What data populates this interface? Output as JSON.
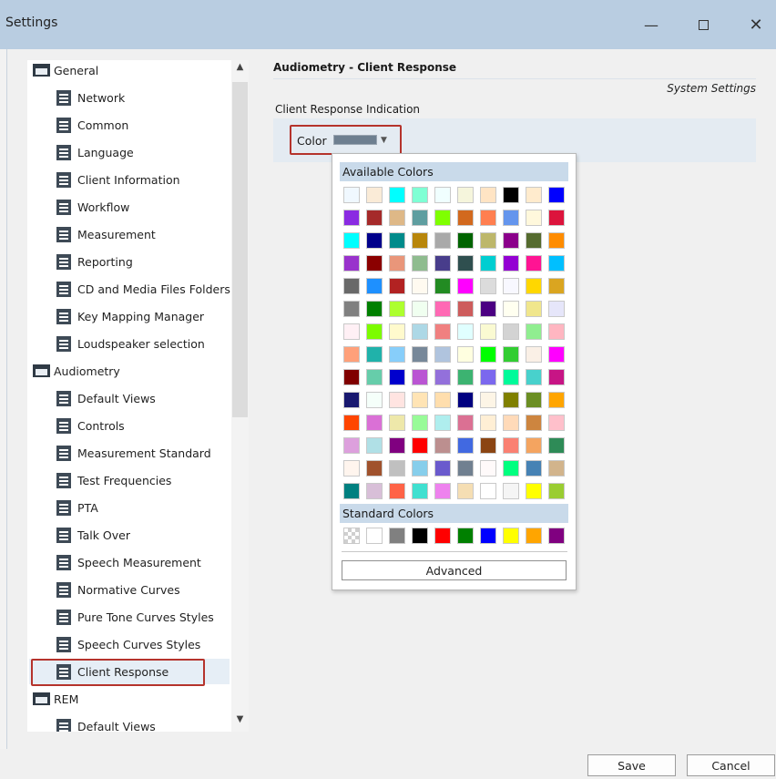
{
  "window": {
    "title": "Settings",
    "minimize": "—",
    "close": "✕"
  },
  "sidebar": {
    "items": [
      {
        "label": "General",
        "type": "folder"
      },
      {
        "label": "Network",
        "type": "doc"
      },
      {
        "label": "Common",
        "type": "doc"
      },
      {
        "label": "Language",
        "type": "doc"
      },
      {
        "label": "Client Information",
        "type": "doc"
      },
      {
        "label": "Workflow",
        "type": "doc"
      },
      {
        "label": "Measurement",
        "type": "doc"
      },
      {
        "label": "Reporting",
        "type": "doc"
      },
      {
        "label": "CD and Media Files Folders",
        "type": "doc"
      },
      {
        "label": "Key Mapping Manager",
        "type": "doc"
      },
      {
        "label": "Loudspeaker selection",
        "type": "doc"
      },
      {
        "label": "Audiometry",
        "type": "folder"
      },
      {
        "label": "Default Views",
        "type": "doc"
      },
      {
        "label": "Controls",
        "type": "doc"
      },
      {
        "label": "Measurement Standard",
        "type": "doc"
      },
      {
        "label": "Test Frequencies",
        "type": "doc"
      },
      {
        "label": "PTA",
        "type": "doc"
      },
      {
        "label": "Talk Over",
        "type": "doc"
      },
      {
        "label": "Speech Measurement",
        "type": "doc"
      },
      {
        "label": "Normative Curves",
        "type": "doc"
      },
      {
        "label": "Pure Tone Curves Styles",
        "type": "doc"
      },
      {
        "label": "Speech Curves Styles",
        "type": "doc"
      },
      {
        "label": "Client Response",
        "type": "doc",
        "selected": true
      },
      {
        "label": "REM",
        "type": "folder"
      },
      {
        "label": "Default Views",
        "type": "doc"
      }
    ]
  },
  "main": {
    "section_title": "Audiometry - Client Response",
    "system_settings": "System Settings",
    "indication_label": "Client Response Indication",
    "color_label": "Color",
    "selected_color": "#6e7f90"
  },
  "color_popup": {
    "available_title": "Available Colors",
    "standard_title": "Standard Colors",
    "advanced_label": "Advanced",
    "available_colors": [
      "#f0f8ff",
      "#faebd7",
      "#00ffff",
      "#7fffd4",
      "#f0ffff",
      "#f5f5dc",
      "#ffe4c4",
      "#000000",
      "#ffebcd",
      "#0000ff",
      "#8a2be2",
      "#a52a2a",
      "#deb887",
      "#5f9ea0",
      "#7fff00",
      "#d2691e",
      "#ff7f50",
      "#6495ed",
      "#fff8dc",
      "#dc143c",
      "#00ffff",
      "#00008b",
      "#008b8b",
      "#b8860b",
      "#a9a9a9",
      "#006400",
      "#bdb76b",
      "#8b008b",
      "#556b2f",
      "#ff8c00",
      "#9932cc",
      "#8b0000",
      "#e9967a",
      "#8fbc8f",
      "#483d8b",
      "#2f4f4f",
      "#00ced1",
      "#9400d3",
      "#ff1493",
      "#00bfff",
      "#696969",
      "#1e90ff",
      "#b22222",
      "#fffaf0",
      "#228b22",
      "#ff00ff",
      "#dcdcdc",
      "#f8f8ff",
      "#ffd700",
      "#daa520",
      "#808080",
      "#008000",
      "#adff2f",
      "#f0fff0",
      "#ff69b4",
      "#cd5c5c",
      "#4b0082",
      "#fffff0",
      "#f0e68c",
      "#e6e6fa",
      "#fff0f5",
      "#7cfc00",
      "#fffacd",
      "#add8e6",
      "#f08080",
      "#e0ffff",
      "#fafad2",
      "#d3d3d3",
      "#90ee90",
      "#ffb6c1",
      "#ffa07a",
      "#20b2aa",
      "#87cefa",
      "#778899",
      "#b0c4de",
      "#ffffe0",
      "#00ff00",
      "#32cd32",
      "#faf0e6",
      "#ff00ff",
      "#800000",
      "#66cdaa",
      "#0000cd",
      "#ba55d3",
      "#9370db",
      "#3cb371",
      "#7b68ee",
      "#00fa9a",
      "#48d1cc",
      "#c71585",
      "#191970",
      "#f5fffa",
      "#ffe4e1",
      "#ffe4b5",
      "#ffdead",
      "#000080",
      "#fdf5e6",
      "#808000",
      "#6b8e23",
      "#ffa500",
      "#ff4500",
      "#da70d6",
      "#eee8aa",
      "#98fb98",
      "#afeeee",
      "#db7093",
      "#ffefd5",
      "#ffdab9",
      "#cd853f",
      "#ffc0cb",
      "#dda0dd",
      "#b0e0e6",
      "#800080",
      "#ff0000",
      "#bc8f8f",
      "#4169e1",
      "#8b4513",
      "#fa8072",
      "#f4a460",
      "#2e8b57",
      "#fff5ee",
      "#a0522d",
      "#c0c0c0",
      "#87ceeb",
      "#6a5acd",
      "#708090",
      "#fffafa",
      "#00ff7f",
      "#4682b4",
      "#d2b48c",
      "#008080",
      "#d8bfd8",
      "#ff6347",
      "#40e0d0",
      "#ee82ee",
      "#f5deb3",
      "#ffffff",
      "#f5f5f5",
      "#ffff00",
      "#9acd32"
    ],
    "standard_colors": [
      "transparent",
      "#ffffff",
      "#808080",
      "#000000",
      "#ff0000",
      "#008000",
      "#0000ff",
      "#ffff00",
      "#ffa500",
      "#800080"
    ]
  },
  "footer": {
    "save_label": "Save",
    "cancel_label": "Cancel"
  }
}
